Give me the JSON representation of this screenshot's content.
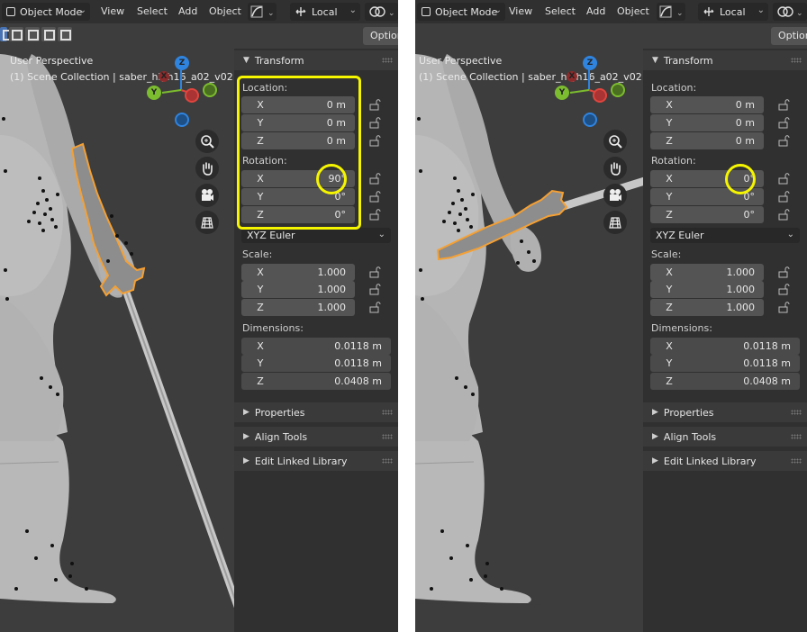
{
  "panels": [
    {
      "id": "before",
      "header": {
        "mode": "Object Mode",
        "menus": [
          "View",
          "Select",
          "Add",
          "Object"
        ],
        "orientation": "Local",
        "options": "Options"
      },
      "viewport": {
        "perspective": "User Perspective",
        "collection": "(1) Scene Collection | saber_high16_a02_v02",
        "gizmo": {
          "x": "X",
          "y": "Y",
          "z": "Z"
        }
      },
      "transform": {
        "title": "Transform",
        "location_label": "Location:",
        "location": [
          {
            "axis": "X",
            "value": "0 m"
          },
          {
            "axis": "Y",
            "value": "0 m"
          },
          {
            "axis": "Z",
            "value": "0 m"
          }
        ],
        "rotation_label": "Rotation:",
        "rotation": [
          {
            "axis": "X",
            "value": "90°"
          },
          {
            "axis": "Y",
            "value": "0°"
          },
          {
            "axis": "Z",
            "value": "0°"
          }
        ],
        "rotation_mode": "XYZ Euler",
        "scale_label": "Scale:",
        "scale": [
          {
            "axis": "X",
            "value": "1.000"
          },
          {
            "axis": "Y",
            "value": "1.000"
          },
          {
            "axis": "Z",
            "value": "1.000"
          }
        ],
        "dimensions_label": "Dimensions:",
        "dimensions": [
          {
            "axis": "X",
            "value": "0.0118 m"
          },
          {
            "axis": "Y",
            "value": "0.0118 m"
          },
          {
            "axis": "Z",
            "value": "0.0408 m"
          }
        ]
      },
      "sections": [
        "Properties",
        "Align Tools",
        "Edit Linked Library"
      ]
    },
    {
      "id": "after",
      "header": {
        "mode": "Object Mode",
        "menus": [
          "View",
          "Select",
          "Add",
          "Object"
        ],
        "orientation": "Local",
        "options": "Options"
      },
      "viewport": {
        "perspective": "User Perspective",
        "collection": "(1) Scene Collection | saber_high16_a02_v02",
        "gizmo": {
          "x": "X",
          "y": "Y",
          "z": "Z"
        }
      },
      "transform": {
        "title": "Transform",
        "location_label": "Location:",
        "location": [
          {
            "axis": "X",
            "value": "0 m"
          },
          {
            "axis": "Y",
            "value": "0 m"
          },
          {
            "axis": "Z",
            "value": "0 m"
          }
        ],
        "rotation_label": "Rotation:",
        "rotation": [
          {
            "axis": "X",
            "value": "0°"
          },
          {
            "axis": "Y",
            "value": "0°"
          },
          {
            "axis": "Z",
            "value": "0°"
          }
        ],
        "rotation_mode": "XYZ Euler",
        "scale_label": "Scale:",
        "scale": [
          {
            "axis": "X",
            "value": "1.000"
          },
          {
            "axis": "Y",
            "value": "1.000"
          },
          {
            "axis": "Z",
            "value": "1.000"
          }
        ],
        "dimensions_label": "Dimensions:",
        "dimensions": [
          {
            "axis": "X",
            "value": "0.0118 m"
          },
          {
            "axis": "Y",
            "value": "0.0118 m"
          },
          {
            "axis": "Z",
            "value": "0.0408 m"
          }
        ]
      },
      "sections": [
        "Properties",
        "Align Tools",
        "Edit Linked Library"
      ]
    }
  ],
  "colors": {
    "highlight": "#f5f500",
    "selection_outline": "#f5a033",
    "viewport_bg": "#3d3d3d",
    "sidebar_bg": "#303030",
    "field_bg": "#545454",
    "axis_x": "#e0453e",
    "axis_y": "#7cbd2f",
    "axis_z": "#2f84e0"
  },
  "icons": [
    "zoom-icon",
    "hand-pan-icon",
    "camera-icon",
    "grid-icon",
    "lock-icon",
    "link-icon",
    "transform-orientation-icon"
  ]
}
